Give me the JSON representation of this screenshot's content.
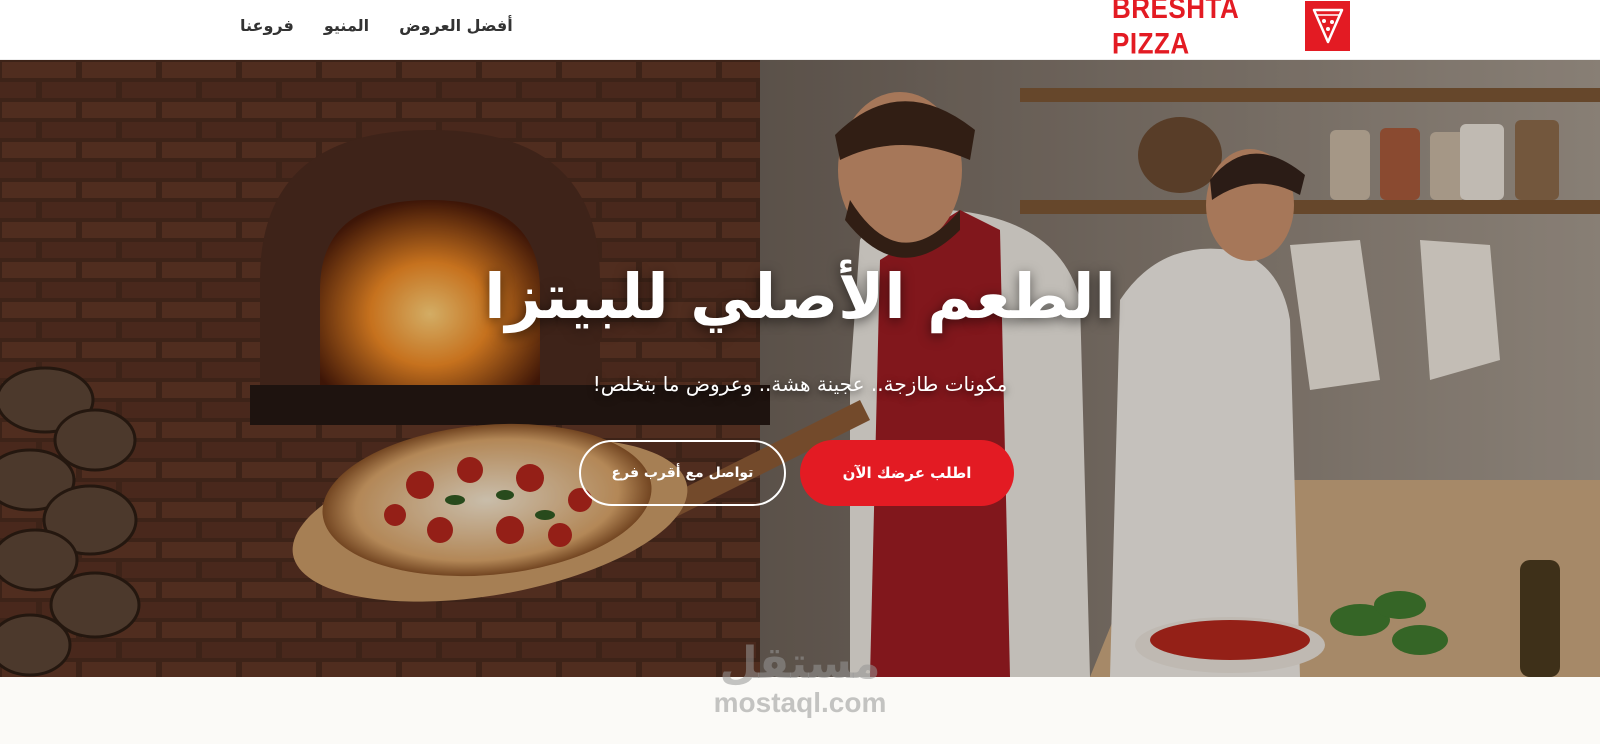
{
  "header": {
    "logo_text": "BRESHTA PIZZA",
    "nav": [
      {
        "label": "أفضل العروض"
      },
      {
        "label": "المنيو"
      },
      {
        "label": "فروعنا"
      }
    ]
  },
  "hero": {
    "title": "الطعم الأصلي للبيتزا",
    "subtitle": "مكونات طازجة.. عجينة هشة.. وعروض ما بتخلص!",
    "primary_button": "اطلب عرضك الآن",
    "secondary_button": "تواصل مع أقرب فرع"
  },
  "watermark": {
    "arabic": "مستقل",
    "latin": "mostaql.com"
  },
  "colors": {
    "brand_red": "#e31b23",
    "header_bg": "#ffffff",
    "nav_text": "#333333",
    "page_bg": "#fbfaf7"
  },
  "icons": {
    "logo_badge": "pizza-slice-icon"
  }
}
